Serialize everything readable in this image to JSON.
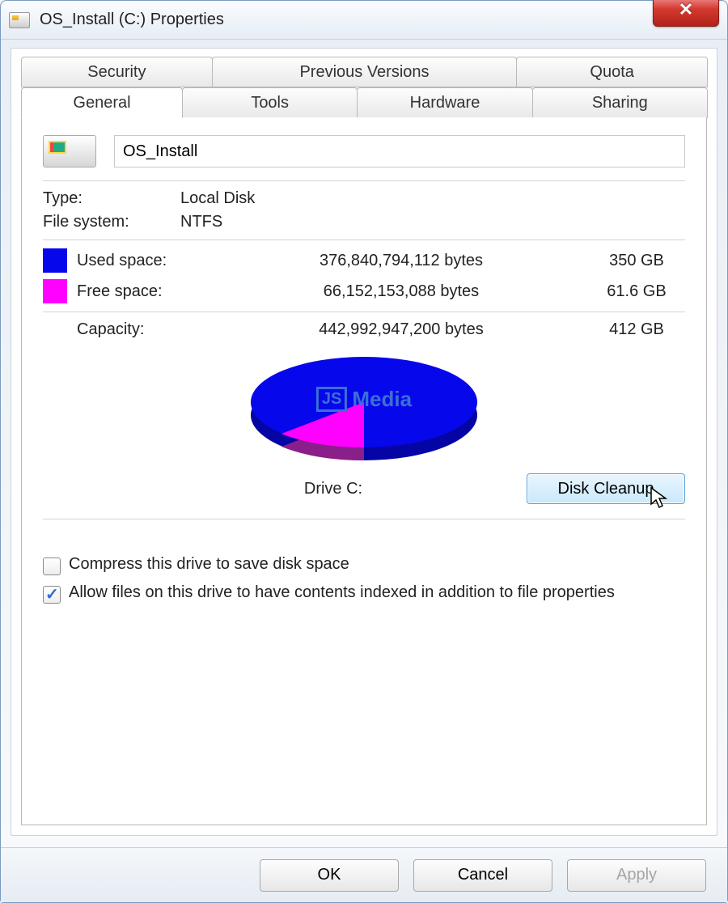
{
  "window": {
    "title": "OS_Install (C:) Properties"
  },
  "tabs_top": [
    "Security",
    "Previous Versions",
    "Quota"
  ],
  "tabs_bottom": [
    "General",
    "Tools",
    "Hardware",
    "Sharing"
  ],
  "active_tab": "General",
  "drive_name": "OS_Install",
  "type_label": "Type:",
  "type_value": "Local Disk",
  "fs_label": "File system:",
  "fs_value": "NTFS",
  "used": {
    "label": "Used space:",
    "bytes": "376,840,794,112 bytes",
    "gb": "350 GB"
  },
  "free": {
    "label": "Free space:",
    "bytes": "66,152,153,088 bytes",
    "gb": "61.6 GB"
  },
  "capacity": {
    "label": "Capacity:",
    "bytes": "442,992,947,200 bytes",
    "gb": "412 GB"
  },
  "drive_label": "Drive C:",
  "disk_cleanup": "Disk Cleanup",
  "compress_label": "Compress this drive to save disk space",
  "index_label": "Allow files on this drive to have contents indexed in addition to file properties",
  "colors": {
    "used": "#0707eb",
    "free": "#ff02ff"
  },
  "watermark": {
    "box": "JS",
    "text": "Media"
  },
  "buttons": {
    "ok": "OK",
    "cancel": "Cancel",
    "apply": "Apply"
  },
  "checks": {
    "compress": false,
    "index": true
  },
  "chart_data": {
    "type": "pie",
    "title": "Drive C:",
    "series": [
      {
        "name": "Used space",
        "value": 376840794112,
        "value_gb": 350,
        "color": "#0707eb"
      },
      {
        "name": "Free space",
        "value": 66152153088,
        "value_gb": 61.6,
        "color": "#ff02ff"
      }
    ],
    "total": 442992947200,
    "total_gb": 412
  }
}
